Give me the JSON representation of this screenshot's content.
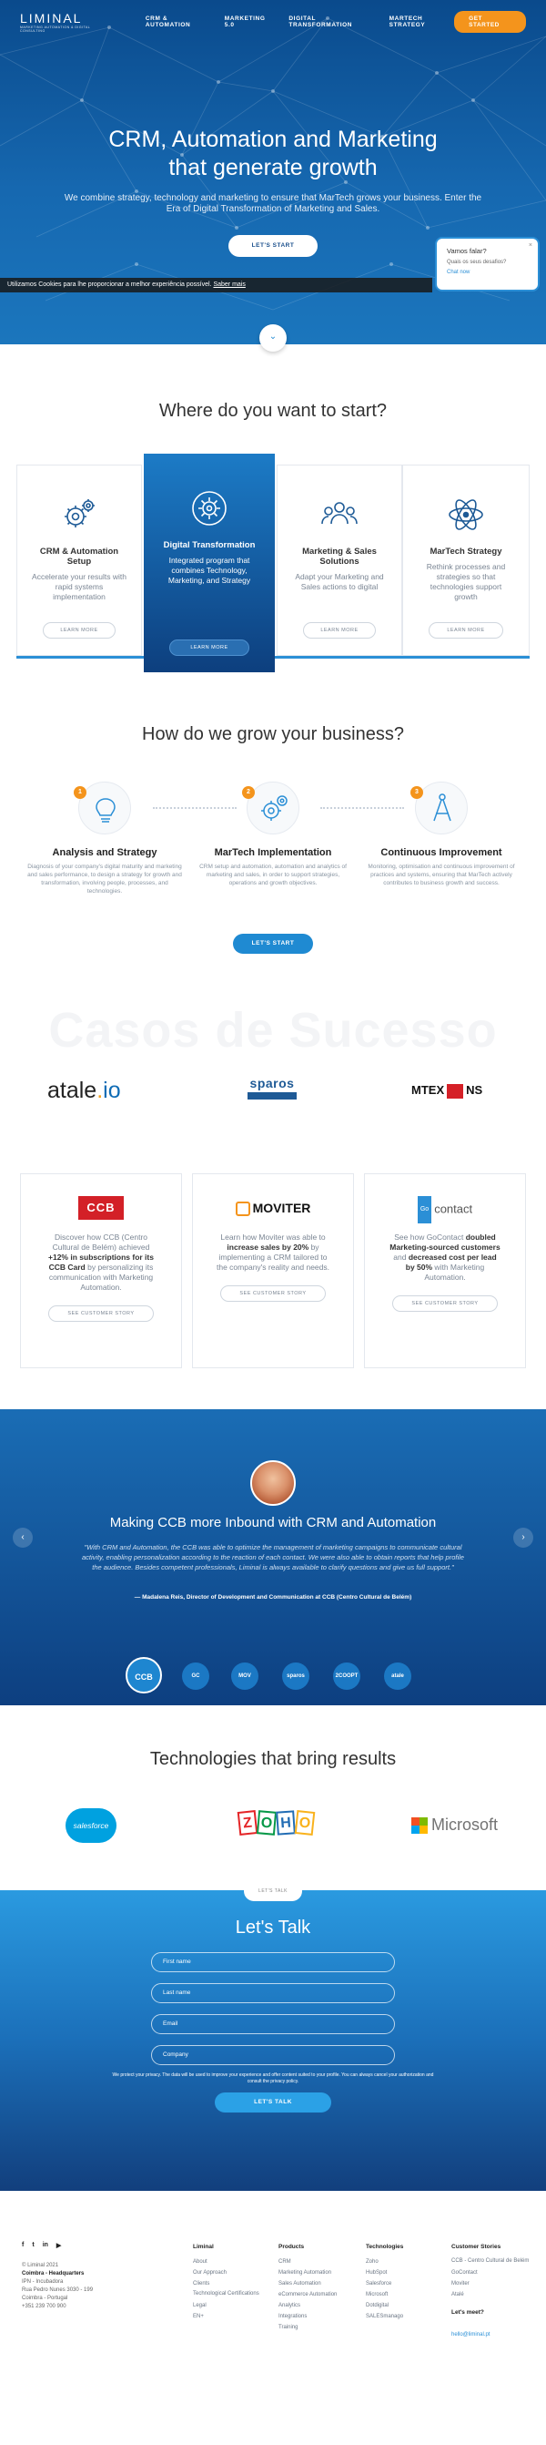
{
  "nav": {
    "logo_name": "LIMINAL",
    "logo_sub": "MARKETING AUTOMATION & DIGITAL CONSULTING",
    "links": [
      "CRM & AUTOMATION",
      "MARKETING 5.0",
      "DIGITAL TRANSFORMATION",
      "MARTECH STRATEGY"
    ],
    "cta": "GET STARTED"
  },
  "hero": {
    "title_line1": "CRM, Automation and Marketing",
    "title_line2": "that generate growth",
    "text": "We combine strategy, technology and marketing to ensure that MarTech grows your business. Enter the Era of Digital Transformation of Marketing and Sales.",
    "button": "LET'S START"
  },
  "cookie": {
    "text": "Utilizamos Cookies para lhe proporcionar a melhor experiência possível.",
    "link": "Saber mais"
  },
  "chat": {
    "title": "Vamos falar?",
    "question": "Quais os seus desafios?",
    "link": "Chat now",
    "close": "×"
  },
  "start": {
    "title": "Where do you want to start?",
    "cards": [
      {
        "title": "CRM & Automation Setup",
        "text": "Accelerate your results with rapid systems implementation",
        "button": "LEARN MORE"
      },
      {
        "title": "Digital Transformation",
        "text": "Integrated program that combines Technology, Marketing, and Strategy",
        "button": "LEARN MORE"
      },
      {
        "title": "Marketing & Sales Solutions",
        "text": "Adapt your Marketing and Sales actions to digital",
        "button": "LEARN MORE"
      },
      {
        "title": "MarTech Strategy",
        "text": "Rethink processes and strategies so that technologies support growth",
        "button": "LEARN MORE"
      }
    ]
  },
  "grow": {
    "title": "How do we grow your business?",
    "steps": [
      {
        "num": "1",
        "title": "Analysis and Strategy",
        "text": "Diagnosis of your company's digital maturity and marketing and sales performance, to design a strategy for growth and transformation, involving people, processes, and technologies."
      },
      {
        "num": "2",
        "title": "MarTech Implementation",
        "text": "CRM setup and automation, automation and analytics of marketing and sales, in order to support strategies, operations and growth objectives."
      },
      {
        "num": "3",
        "title": "Continuous Improvement",
        "text": "Monitoring, optimisation and continuous improvement of practices and systems, ensuring that MarTech actively contributes to business growth and success."
      }
    ],
    "button": "LET'S START"
  },
  "cases": {
    "bg_title": "Casos de Sucesso",
    "client_logos": {
      "atale": [
        "atale",
        ".",
        "io"
      ],
      "sparos": "sparos",
      "mtex": [
        "MTEX",
        "NS"
      ]
    },
    "cards": [
      {
        "logo": "CCB",
        "pre": "Discover how CCB (Centro Cultural de Belém) achieved ",
        "b1": "+12% in subscriptions for its CCB Card",
        "mid": " by personalizing its communication with Marketing Automation.",
        "b2": "",
        "post": "",
        "button": "SEE CUSTOMER STORY"
      },
      {
        "logo": "MOVITER",
        "pre": "Learn how Moviter was able to ",
        "b1": "increase sales by 20%",
        "mid": " by implementing a CRM tailored to the company's reality and needs.",
        "b2": "",
        "post": "",
        "button": "SEE CUSTOMER STORY"
      },
      {
        "logo_g": "Go",
        "logo": "contact",
        "pre": "See how GoContact ",
        "b1": "doubled Marketing-sourced customers",
        "mid": " and ",
        "b2": "decreased cost per lead by 50%",
        "post": " with Marketing Automation.",
        "button": "SEE CUSTOMER STORY"
      }
    ]
  },
  "testimonial": {
    "title": "Making CCB more Inbound with CRM and Automation",
    "quote": "\"With CRM and Automation, the CCB was able to optimize the management of marketing campaigns to communicate cultural activity, enabling personalization according to the reaction of each contact. We were also able to obtain reports that help profile the audience. Besides competent professionals, Liminal is always available to clarify questions and give us full support.\"",
    "author": "— Madalena Reis, Director of Development and Communication at CCB (Centro Cultural de Belém)",
    "prev": "‹",
    "next": "›",
    "thumbs": [
      "CCB",
      "GC",
      "MOV",
      "sparos",
      "2COOPT",
      "atale"
    ]
  },
  "tech": {
    "title": "Technologies that bring results",
    "salesforce": "salesforce",
    "zoho": [
      "Z",
      "O",
      "H",
      "O"
    ],
    "microsoft": "Microsoft"
  },
  "contact": {
    "tab": "LET'S TALK",
    "title": "Let's Talk",
    "fields": [
      "First name",
      "Last name",
      "Email",
      "Company"
    ],
    "note": "We protect your privacy. The data will be used to improve your experience and offer content suited to your profile. You can always cancel your authorization and consult the privacy policy.",
    "button": "LET'S TALK"
  },
  "footer": {
    "social": [
      "f",
      "t",
      "in",
      "▶"
    ],
    "copyright": "© Liminal 2021",
    "office": "Coimbra - Headquarters",
    "address": [
      "IPN - Incubadora",
      "Rua Pedro Nunes 3030 - 199",
      "Coimbra - Portugal"
    ],
    "phone": "+351 239 700 900",
    "columns": [
      {
        "heading": "Liminal",
        "items": [
          "About",
          "Our Approach",
          "Clients",
          "Technological Certifications",
          "Legal",
          "EN+"
        ]
      },
      {
        "heading": "Products",
        "items": [
          "CRM",
          "Marketing Automation",
          "Sales Automation",
          "eCommerce Automation",
          "Analytics",
          "Integrations",
          "Training"
        ]
      },
      {
        "heading": "Technologies",
        "items": [
          "Zoho",
          "HubSpot",
          "Salesforce",
          "Microsoft",
          "Dotdigital",
          "SALESmanago"
        ]
      },
      {
        "heading": "Customer Stories",
        "items": [
          "CCB - Centro Cultural de Belém",
          "GoContact",
          "Moviter",
          "Atalé"
        ]
      }
    ],
    "meet_heading": "Let's meet?",
    "email": "hello@liminal.pt"
  },
  "colors": {
    "primary": "#1b76bd",
    "accent": "#f4941c",
    "dark_blue": "#0d3f7e"
  }
}
